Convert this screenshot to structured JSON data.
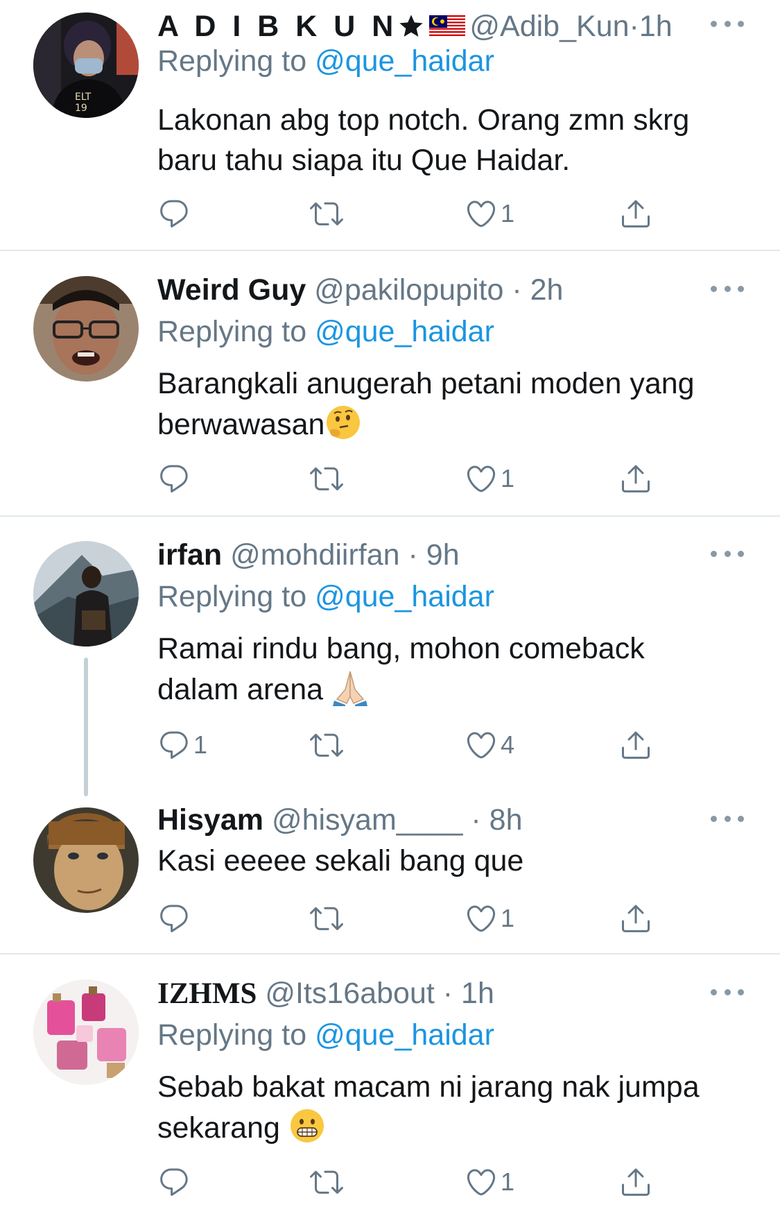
{
  "colors": {
    "link": "#1b95e0",
    "muted": "#657786",
    "text": "#14171a",
    "divider": "#e1e8ed"
  },
  "tweets": [
    {
      "name": "A D I B K U N",
      "handle": "@Adib_Kun",
      "time": "1h",
      "replying_label": "Replying to ",
      "replying_to": "@que_haidar",
      "text_line1": "Lakonan abg top notch. Orang zmn skrg",
      "text_line2": "baru tahu siapa itu Que Haidar.",
      "reply_count": "",
      "like_count": "1"
    },
    {
      "name": "Weird Guy",
      "handle": "@pakilopupito",
      "time": "2h",
      "replying_label": "Replying to ",
      "replying_to": "@que_haidar",
      "text_line1": "Barangkali anugerah petani moden yang",
      "text_line2": "berwawasan",
      "reply_count": "",
      "like_count": "1"
    },
    {
      "name": "irfan",
      "handle": "@mohdiirfan",
      "time": "9h",
      "replying_label": "Replying to ",
      "replying_to": "@que_haidar",
      "text_line1": "Ramai rindu bang, mohon comeback",
      "text_line2": "dalam arena ",
      "reply_count": "1",
      "like_count": "4"
    },
    {
      "name": "Hisyam",
      "handle": "@hisyam____",
      "time": "8h",
      "text_line1": "Kasi eeeee sekali bang que",
      "reply_count": "",
      "like_count": "1"
    },
    {
      "name": "IZHMS",
      "handle": "@Its16about",
      "time": "1h",
      "replying_label": "Replying to ",
      "replying_to": "@que_haidar",
      "text_line1": "Sebab bakat macam ni jarang nak jumpa",
      "text_line2": "sekarang ",
      "reply_count": "",
      "like_count": "1"
    }
  ]
}
